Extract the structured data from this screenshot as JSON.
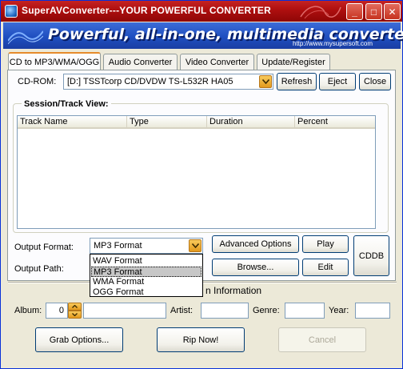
{
  "window": {
    "title": "SuperAVConverter---YOUR POWERFUL CONVERTER",
    "minimize": "_",
    "maximize": "□",
    "close": "✕"
  },
  "banner": {
    "headline": "Powerful, all-in-one, multimedia converter!",
    "url": "http://www.mysupersoft.com"
  },
  "tabs": [
    {
      "label": "CD to MP3/WMA/OGG",
      "active": true
    },
    {
      "label": "Audio Converter",
      "active": false
    },
    {
      "label": "Video Converter",
      "active": false
    },
    {
      "label": "Update/Register",
      "active": false
    }
  ],
  "cdrom": {
    "label": "CD-ROM:",
    "value": "[D:] TSSTcorp CD/DVDW TS-L532R HA05",
    "refresh": "Refresh",
    "eject": "Eject",
    "close": "Close"
  },
  "session": {
    "title": "Session/Track View:",
    "columns": [
      "Track Name",
      "Type",
      "Duration",
      "Percent"
    ]
  },
  "output": {
    "format_label": "Output Format:",
    "format_value": "MP3 Format",
    "path_label": "Output Path:",
    "format_options": [
      "WAV Format",
      "MP3 Format",
      "WMA Format",
      "OGG Format"
    ],
    "selected_option_index": 1,
    "advanced_options": "Advanced Options",
    "play": "Play",
    "browse": "Browse...",
    "edit": "Edit",
    "cddb": "CDDB"
  },
  "info": {
    "section_label": "n Information",
    "album_label": "Album:",
    "album_number": "0",
    "artist_label": "Artist:",
    "genre_label": "Genre:",
    "year_label": "Year:"
  },
  "actions": {
    "grab_options": "Grab Options...",
    "rip_now": "Rip Now!",
    "cancel": "Cancel"
  },
  "colors": {
    "titlebar": "#b01010",
    "banner": "#1f4fc0",
    "button_border": "#003c74",
    "tab_highlight": "#e68b2c"
  }
}
